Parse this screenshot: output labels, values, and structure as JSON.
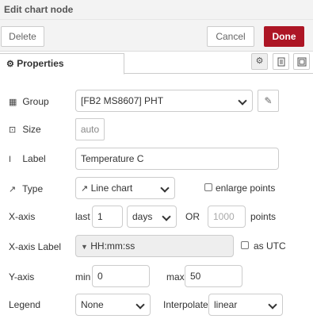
{
  "window": {
    "title": "Edit chart node"
  },
  "toolbar": {
    "delete_label": "Delete",
    "cancel_label": "Cancel",
    "done_label": "Done"
  },
  "tabs": {
    "properties_label": "Properties"
  },
  "form": {
    "group": {
      "label": "Group",
      "value": "[FB2 MS8607] PHT",
      "icon": "table-icon"
    },
    "size": {
      "label": "Size",
      "value": "auto",
      "icon": "resize-icon"
    },
    "label": {
      "label": "Label",
      "value": "Temperature  C",
      "icon": "text-cursor-icon"
    },
    "type": {
      "label": "Type",
      "value": "Line chart",
      "enlarge_label": "enlarge points",
      "enlarge_checked": false,
      "icon": "line-chart-icon"
    },
    "xaxis": {
      "label": "X-axis",
      "last_label": "last",
      "last_value": "1",
      "unit_value": "days",
      "or_label": "OR",
      "points_placeholder": "1000",
      "points_label": "points"
    },
    "xaxis_label": {
      "label": "X-axis Label",
      "value": "HH:mm:ss",
      "utc_label": "as UTC",
      "utc_checked": false
    },
    "yaxis": {
      "label": "Y-axis",
      "min_label": "min",
      "min_value": "0",
      "max_label": "max",
      "max_value": "50"
    },
    "legend": {
      "label": "Legend",
      "value": "None",
      "interpolate_label": "Interpolate",
      "interpolate_value": "linear"
    }
  }
}
